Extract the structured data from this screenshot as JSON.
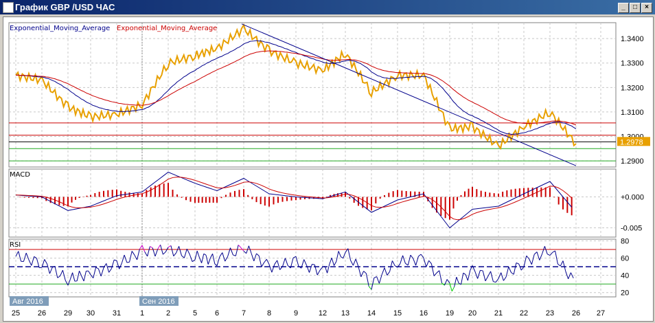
{
  "window": {
    "title": "График GBP /USD  ЧАС",
    "min": "_",
    "max": "□",
    "close": "×"
  },
  "legend": {
    "ema1": "Exponential_Moving_Average",
    "ema2": "Exponential_Moving_Average",
    "ema1_color": "#00008b",
    "ema2_color": "#cc0000"
  },
  "price_axis": [
    "1.3400",
    "1.3300",
    "1.3200",
    "1.3100",
    "1.3000",
    "1.2900"
  ],
  "current_price": "1.2978",
  "macd": {
    "title": "MACD",
    "ticks": [
      "+0.000",
      "-0.005"
    ]
  },
  "rsi": {
    "title": "RSI",
    "ticks": [
      "80",
      "60",
      "40",
      "20"
    ]
  },
  "month_labels": [
    "Авг 2016",
    "Сен 2016"
  ],
  "chart_data": {
    "type": "line",
    "x": [
      "25",
      "26",
      "29",
      "30",
      "31",
      "1",
      "2",
      "5",
      "6",
      "7",
      "8",
      "9",
      "12",
      "13",
      "14",
      "15",
      "16",
      "19",
      "20",
      "21",
      "22",
      "23",
      "26",
      "27"
    ],
    "price": [
      1.325,
      1.323,
      1.312,
      1.308,
      1.309,
      1.313,
      1.33,
      1.333,
      1.336,
      1.344,
      1.335,
      1.33,
      1.327,
      1.334,
      1.318,
      1.325,
      1.325,
      1.303,
      1.304,
      1.296,
      1.304,
      1.31,
      1.297,
      null
    ],
    "price_ylim": [
      1.2875,
      1.3465
    ],
    "hlines_red": [
      1.3055,
      1.3005
    ],
    "hline_black": 1.2978,
    "hlines_green": [
      1.295,
      1.29
    ],
    "trendline": [
      [
        7,
        1.346
      ],
      [
        26,
        1.288
      ]
    ],
    "macd": [
      0.0003,
      0.0,
      -0.0022,
      -0.0015,
      0.0002,
      0.0008,
      0.004,
      0.0022,
      0.001,
      0.003,
      0.0005,
      0.0,
      -0.0003,
      0.0008,
      -0.0025,
      -0.0005,
      0.0005,
      -0.005,
      -0.002,
      -0.0015,
      0.0005,
      0.0025,
      -0.0025,
      null
    ],
    "macd_ylim": [
      -0.0065,
      0.0045
    ],
    "rsi": [
      62,
      55,
      35,
      42,
      52,
      68,
      70,
      62,
      58,
      72,
      50,
      55,
      45,
      68,
      30,
      55,
      60,
      25,
      45,
      35,
      55,
      70,
      30,
      null
    ],
    "rsi_ylim": [
      15,
      82
    ],
    "rsi_levels": [
      70,
      50,
      30
    ]
  }
}
